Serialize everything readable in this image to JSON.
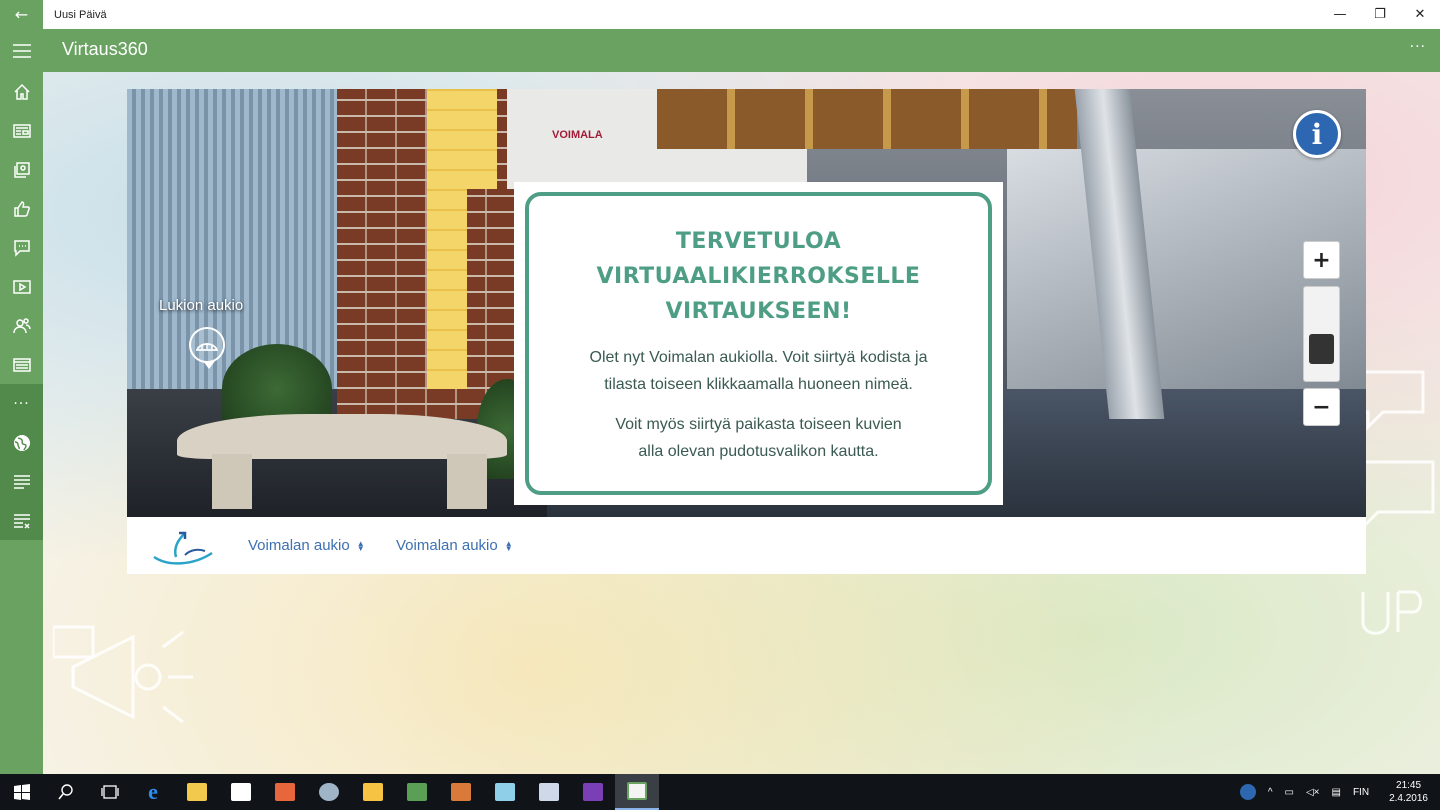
{
  "window": {
    "app_title": "Uusi Päivä",
    "back_glyph": "←",
    "minimize_glyph": "—",
    "restore_glyph": "❐",
    "close_glyph": "✕"
  },
  "header": {
    "page_title": "Virtaus360",
    "more_glyph": "···"
  },
  "sidebar": {
    "items": [
      {
        "name": "home-icon"
      },
      {
        "name": "news-icon"
      },
      {
        "name": "gallery-icon"
      },
      {
        "name": "thumbs-up-icon"
      },
      {
        "name": "chat-icon"
      },
      {
        "name": "video-icon"
      },
      {
        "name": "people-icon"
      },
      {
        "name": "calendar-icon"
      },
      {
        "name": "more-icon"
      },
      {
        "name": "globe-icon",
        "selected": true
      },
      {
        "name": "list-icon"
      },
      {
        "name": "feedback-icon"
      }
    ],
    "more_glyph": "···"
  },
  "panorama": {
    "hotspot_label": "Lukion aukio",
    "logo_text": "VOIMALA",
    "info_glyph": "i",
    "zoom_in": "+",
    "zoom_out": "−",
    "zoom_level": 0.75
  },
  "welcome": {
    "title_line1": "TERVETULOA",
    "title_line2": "VIRTUAALIKIERROKSELLE",
    "title_line3": "VIRTAUKSEEN!",
    "p1_line1": "Olet nyt Voimalan aukiolla. Voit siirtyä kodista ja",
    "p1_line2": "tilasta toiseen klikkaamalla huoneen nimeä.",
    "p2_line1": "Voit myös siirtyä paikasta toiseen kuvien",
    "p2_line2": "alla olevan pudotusvalikon kautta."
  },
  "location_bar": {
    "select1": "Voimalan aukio",
    "select2": "Voimalan aukio"
  },
  "taskbar": {
    "language": "FIN",
    "time": "21:45",
    "date": "2.4.2016"
  },
  "colors": {
    "accent_green": "#6aa262",
    "dialog_teal": "#4e9e85",
    "link_blue": "#3d70b2",
    "info_blue": "#2e67b1"
  }
}
